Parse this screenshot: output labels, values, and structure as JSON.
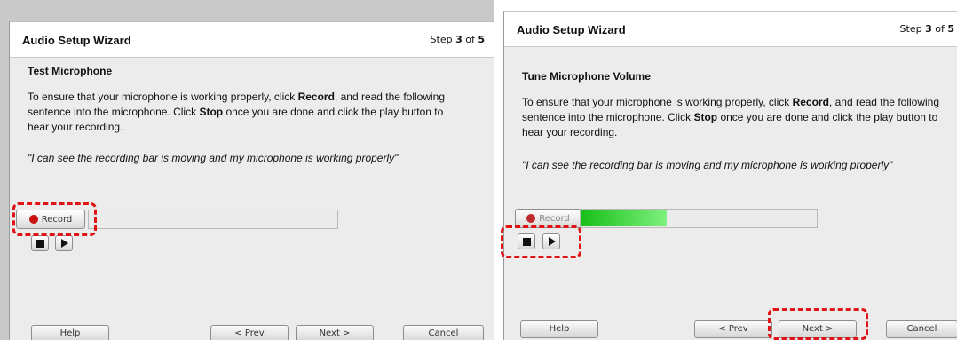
{
  "accent_colors": {
    "highlight": "#e01414",
    "record_dot": "#cc1111",
    "level_bar": "#18c018"
  },
  "left": {
    "title": "Audio Setup Wizard",
    "step": {
      "prefix": "Step",
      "current": "3",
      "of": "of",
      "total": "5"
    },
    "section_title": "Test Microphone",
    "instructions": {
      "part1": "To ensure that your microphone is working properly, click ",
      "record_word": "Record",
      "part2": ", and read the following sentence into the microphone. Click ",
      "stop_word": "Stop",
      "part3": " once you are done and click the play button to hear your recording."
    },
    "quote": "\"I can see the recording bar is moving and my microphone is working properly\"",
    "record_label": "Record",
    "level_fraction": 0,
    "buttons": {
      "help": "Help",
      "prev": "< Prev",
      "next": "Next >",
      "cancel": "Cancel"
    }
  },
  "right": {
    "title": "Audio Setup Wizard",
    "step": {
      "prefix": "Step",
      "current": "3",
      "of": "of",
      "total": "5"
    },
    "section_title": "Tune Microphone Volume",
    "instructions": {
      "part1": "To ensure that your microphone is working properly, click ",
      "record_word": "Record",
      "part2": ", and read the following sentence into the microphone. Click ",
      "stop_word": "Stop",
      "part3": " once you are done and click the play button to hear your recording."
    },
    "quote": "\"I can see the recording bar is moving and my microphone is working properly\"",
    "record_label": "Record",
    "level_fraction": 0.36,
    "buttons": {
      "help": "Help",
      "prev": "< Prev",
      "next": "Next >",
      "cancel": "Cancel"
    }
  }
}
